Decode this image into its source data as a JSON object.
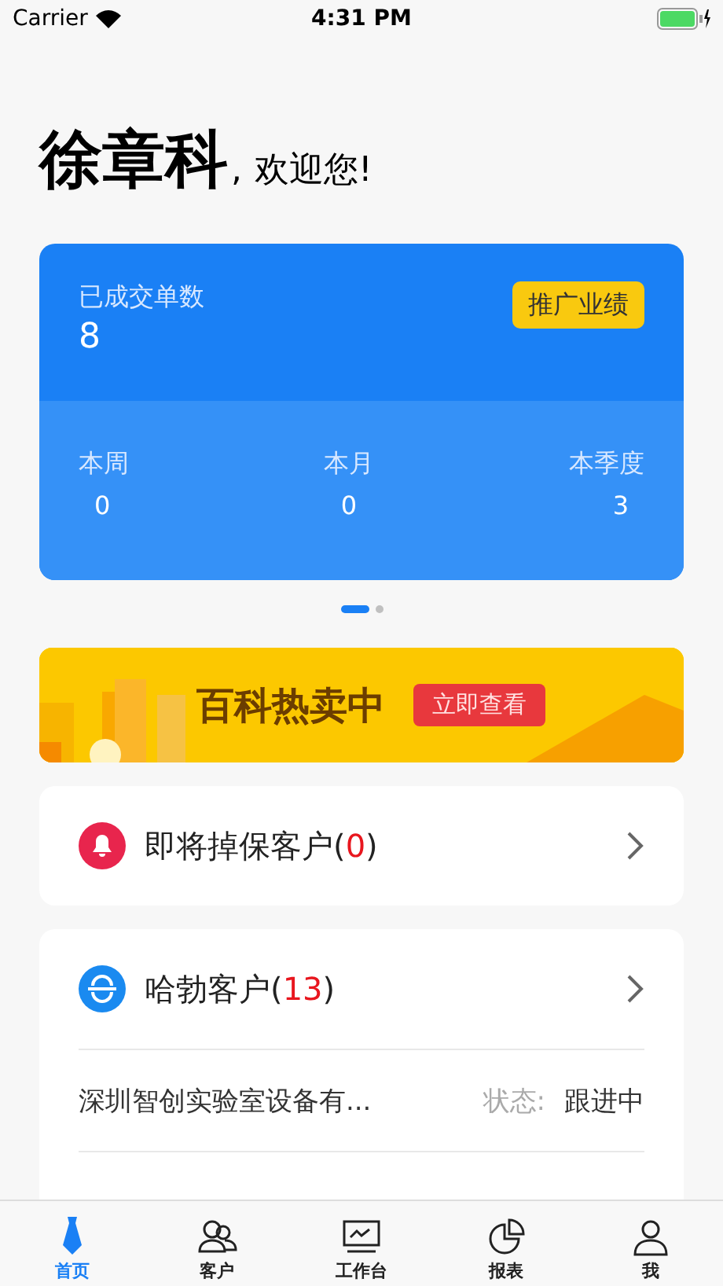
{
  "status_bar": {
    "carrier": "Carrier",
    "time": "4:31 PM"
  },
  "greeting": {
    "name": "徐章科",
    "comma": ",",
    "welcome": "欢迎您!"
  },
  "stats_card": {
    "label": "已成交单数",
    "value": "8",
    "button": "推广业绩",
    "periods": [
      {
        "label": "本周",
        "value": "0"
      },
      {
        "label": "本月",
        "value": "0"
      },
      {
        "label": "本季度",
        "value": "3"
      }
    ]
  },
  "pager": [
    {
      "selected": true
    },
    {
      "selected": false
    }
  ],
  "banner": {
    "title": "百科热卖中",
    "button": "立即查看"
  },
  "alert_card": {
    "title": "即将掉保客户",
    "open": "(",
    "count": "0",
    "close": ")"
  },
  "customers_card": {
    "title": "哈勃客户",
    "open": "(",
    "count": "13",
    "close": ")",
    "rows": [
      {
        "name": "深圳智创实验室设备有...",
        "status_label": "状态:",
        "status": "跟进中"
      }
    ]
  },
  "tab_bar": [
    {
      "label": "首页",
      "kind": "tie",
      "selected": true
    },
    {
      "label": "客户",
      "kind": "people",
      "selected": false
    },
    {
      "label": "工作台",
      "kind": "monitor",
      "selected": false
    },
    {
      "label": "报表",
      "kind": "pie",
      "selected": false
    },
    {
      "label": "我",
      "kind": "person",
      "selected": false
    }
  ]
}
